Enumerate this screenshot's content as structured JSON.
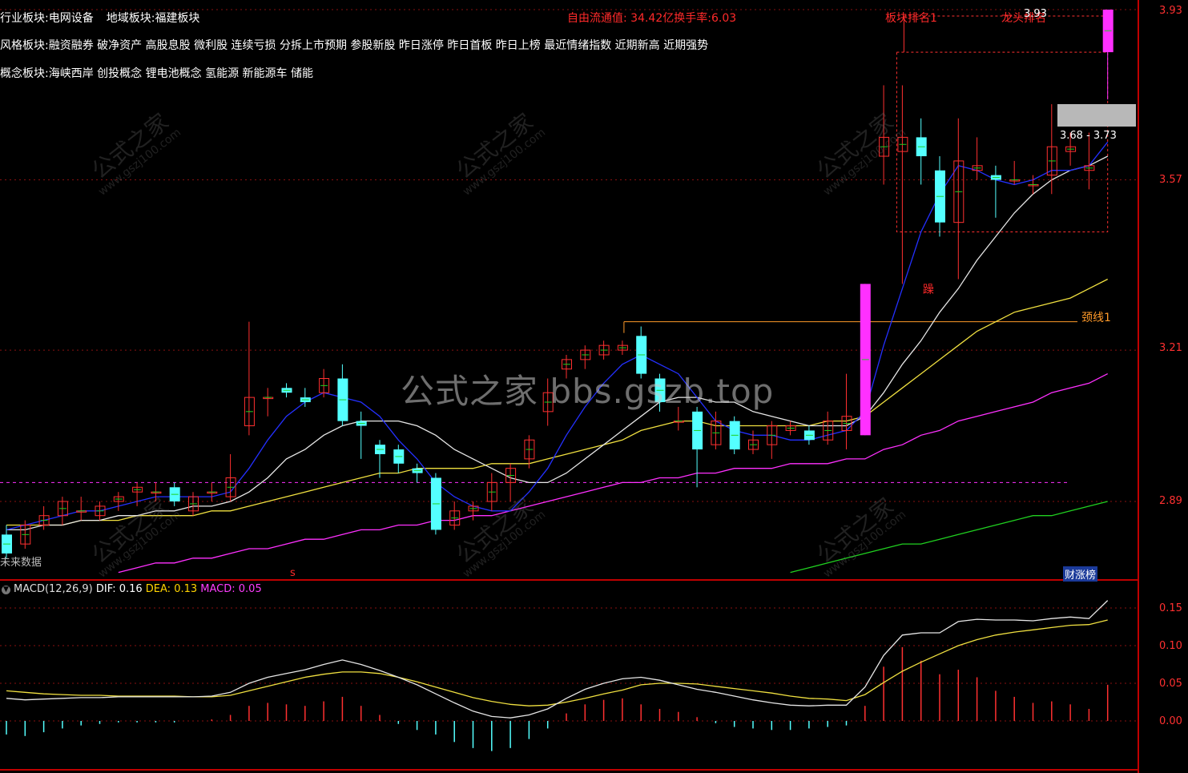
{
  "info": {
    "industry_label": "行业板块:",
    "industry_value": "电网设备",
    "region_label": "地域板块:",
    "region_value": "福建板块",
    "style_label": "风格板块:",
    "style_value": "融资融券 破净资产 高股息股 微利股 连续亏损 分拆上市预期 参股新股 昨日涨停 昨日首板 昨日上榜 最近情绪指数 近期新高 近期强势",
    "concept_label": "概念板块:",
    "concept_value": "海峡西岸 创投概念 锂电池概念 氢能源 新能源车 储能",
    "float_cap": "自由流通值: 34.42亿换手率:6.03"
  },
  "annotations": {
    "neckline": "颈线1",
    "range": "3.68 - 3.73",
    "rank": "板块排名1",
    "rank2": "龙头排名",
    "price_high": "3.93",
    "future_data": "未来数据",
    "flag": "财涨榜",
    "stamp": "躁",
    "s_mark": "s"
  },
  "price_axis": [
    "3.93",
    "3.57",
    "3.21",
    "2.89"
  ],
  "macd_axis": [
    "0.15",
    "0.10",
    "0.05",
    "0.00"
  ],
  "macd": {
    "title": "MACD(12,26,9)",
    "dif": "DIF: 0.16",
    "dea": "DEA: 0.13",
    "macd": "MACD: 0.05"
  },
  "watermark": {
    "main": "公式之家 bbs.gszb.top",
    "small": "公式之家",
    "url": "www.gszj100.com"
  },
  "colors": {
    "up": "#ff3030",
    "down": "#54ffff",
    "ma5": "#2430ff",
    "ma10": "#e6e6e6",
    "ma20": "#f0e040",
    "ma60": "#ff30ff",
    "ma120": "#20d020",
    "limit_up": "#ff30ff"
  },
  "chart_data": {
    "type": "candlestick",
    "price_range": [
      2.77,
      3.93
    ],
    "candles": [
      {
        "o": 2.82,
        "c": 2.78,
        "h": 2.84,
        "l": 2.77
      },
      {
        "o": 2.8,
        "c": 2.84,
        "h": 2.85,
        "l": 2.79
      },
      {
        "o": 2.84,
        "c": 2.86,
        "h": 2.88,
        "l": 2.83
      },
      {
        "o": 2.86,
        "c": 2.89,
        "h": 2.9,
        "l": 2.84
      },
      {
        "o": 2.87,
        "c": 2.87,
        "h": 2.9,
        "l": 2.85
      },
      {
        "o": 2.86,
        "c": 2.88,
        "h": 2.89,
        "l": 2.85
      },
      {
        "o": 2.89,
        "c": 2.9,
        "h": 2.91,
        "l": 2.87
      },
      {
        "o": 2.91,
        "c": 2.92,
        "h": 2.93,
        "l": 2.88
      },
      {
        "o": 2.91,
        "c": 2.91,
        "h": 2.93,
        "l": 2.89
      },
      {
        "o": 2.92,
        "c": 2.89,
        "h": 2.93,
        "l": 2.88
      },
      {
        "o": 2.87,
        "c": 2.9,
        "h": 2.91,
        "l": 2.86
      },
      {
        "o": 2.91,
        "c": 2.91,
        "h": 2.93,
        "l": 2.89
      },
      {
        "o": 2.9,
        "c": 2.94,
        "h": 2.99,
        "l": 2.89
      },
      {
        "o": 3.05,
        "c": 3.11,
        "h": 3.27,
        "l": 3.03
      },
      {
        "o": 3.11,
        "c": 3.11,
        "h": 3.13,
        "l": 3.07
      },
      {
        "o": 3.13,
        "c": 3.12,
        "h": 3.14,
        "l": 3.11
      },
      {
        "o": 3.11,
        "c": 3.1,
        "h": 3.13,
        "l": 3.09
      },
      {
        "o": 3.12,
        "c": 3.15,
        "h": 3.17,
        "l": 3.11
      },
      {
        "o": 3.15,
        "c": 3.06,
        "h": 3.18,
        "l": 3.05
      },
      {
        "o": 3.06,
        "c": 3.05,
        "h": 3.08,
        "l": 2.98
      },
      {
        "o": 3.01,
        "c": 2.99,
        "h": 3.02,
        "l": 2.94
      },
      {
        "o": 3.0,
        "c": 2.97,
        "h": 3.01,
        "l": 2.95
      },
      {
        "o": 2.96,
        "c": 2.95,
        "h": 2.97,
        "l": 2.93
      },
      {
        "o": 2.94,
        "c": 2.83,
        "h": 2.95,
        "l": 2.82
      },
      {
        "o": 2.84,
        "c": 2.87,
        "h": 2.89,
        "l": 2.83
      },
      {
        "o": 2.87,
        "c": 2.88,
        "h": 2.89,
        "l": 2.85
      },
      {
        "o": 2.89,
        "c": 2.93,
        "h": 2.95,
        "l": 2.87
      },
      {
        "o": 2.93,
        "c": 2.96,
        "h": 2.97,
        "l": 2.89
      },
      {
        "o": 2.98,
        "c": 3.02,
        "h": 3.03,
        "l": 2.96
      },
      {
        "o": 3.08,
        "c": 3.12,
        "h": 3.15,
        "l": 3.05
      },
      {
        "o": 3.17,
        "c": 3.19,
        "h": 3.2,
        "l": 3.15
      },
      {
        "o": 3.19,
        "c": 3.21,
        "h": 3.22,
        "l": 3.17
      },
      {
        "o": 3.2,
        "c": 3.22,
        "h": 3.23,
        "l": 3.19
      },
      {
        "o": 3.21,
        "c": 3.22,
        "h": 3.23,
        "l": 3.2
      },
      {
        "o": 3.24,
        "c": 3.16,
        "h": 3.26,
        "l": 3.15
      },
      {
        "o": 3.15,
        "c": 3.1,
        "h": 3.16,
        "l": 3.08
      },
      {
        "o": 3.06,
        "c": 3.06,
        "h": 3.09,
        "l": 3.04
      },
      {
        "o": 3.08,
        "c": 3.0,
        "h": 3.09,
        "l": 2.92
      },
      {
        "o": 3.01,
        "c": 3.06,
        "h": 3.08,
        "l": 3.0
      },
      {
        "o": 3.06,
        "c": 3.0,
        "h": 3.07,
        "l": 2.99
      },
      {
        "o": 3.0,
        "c": 3.02,
        "h": 3.04,
        "l": 2.99
      },
      {
        "o": 3.01,
        "c": 3.05,
        "h": 3.06,
        "l": 2.98
      },
      {
        "o": 3.04,
        "c": 3.05,
        "h": 3.06,
        "l": 3.03
      },
      {
        "o": 3.04,
        "c": 3.02,
        "h": 3.05,
        "l": 3.01
      },
      {
        "o": 3.02,
        "c": 3.06,
        "h": 3.08,
        "l": 3.01
      },
      {
        "o": 3.04,
        "c": 3.07,
        "h": 3.16,
        "l": 3.0
      },
      {
        "o": 3.03,
        "c": 3.35,
        "h": 3.35,
        "l": 3.03
      },
      {
        "o": 3.62,
        "c": 3.66,
        "h": 3.77,
        "l": 3.56
      },
      {
        "o": 3.63,
        "c": 3.66,
        "h": 3.77,
        "l": 3.35
      },
      {
        "o": 3.66,
        "c": 3.62,
        "h": 3.7,
        "l": 3.56
      },
      {
        "o": 3.59,
        "c": 3.48,
        "h": 3.62,
        "l": 3.45
      },
      {
        "o": 3.48,
        "c": 3.61,
        "h": 3.7,
        "l": 3.36
      },
      {
        "o": 3.59,
        "c": 3.6,
        "h": 3.66,
        "l": 3.57
      },
      {
        "o": 3.58,
        "c": 3.57,
        "h": 3.6,
        "l": 3.49
      },
      {
        "o": 3.57,
        "c": 3.57,
        "h": 3.61,
        "l": 3.56
      },
      {
        "o": 3.56,
        "c": 3.56,
        "h": 3.58,
        "l": 3.54
      },
      {
        "o": 3.58,
        "c": 3.64,
        "h": 3.73,
        "l": 3.54
      },
      {
        "o": 3.63,
        "c": 3.64,
        "h": 3.67,
        "l": 3.6
      },
      {
        "o": 3.59,
        "c": 3.6,
        "h": 3.67,
        "l": 3.55
      },
      {
        "o": 3.84,
        "c": 3.93,
        "h": 3.93,
        "l": 3.74
      }
    ],
    "limit_up_days": [
      46,
      59
    ],
    "ma5": [
      2.83,
      2.84,
      2.85,
      2.86,
      2.87,
      2.87,
      2.88,
      2.89,
      2.9,
      2.9,
      2.9,
      2.9,
      2.91,
      2.96,
      3.02,
      3.07,
      3.1,
      3.12,
      3.11,
      3.1,
      3.07,
      3.02,
      2.98,
      2.93,
      2.9,
      2.88,
      2.87,
      2.87,
      2.91,
      2.96,
      3.03,
      3.09,
      3.14,
      3.18,
      3.2,
      3.18,
      3.16,
      3.11,
      3.06,
      3.04,
      3.03,
      3.03,
      3.02,
      3.02,
      3.03,
      3.04,
      3.08,
      3.22,
      3.34,
      3.46,
      3.54,
      3.6,
      3.59,
      3.57,
      3.56,
      3.57,
      3.59,
      3.59,
      3.6,
      3.65
    ],
    "ma10": [
      2.83,
      2.83,
      2.84,
      2.84,
      2.85,
      2.85,
      2.86,
      2.86,
      2.87,
      2.87,
      2.88,
      2.88,
      2.89,
      2.91,
      2.94,
      2.98,
      3.0,
      3.03,
      3.05,
      3.06,
      3.06,
      3.06,
      3.05,
      3.03,
      3.0,
      2.98,
      2.96,
      2.94,
      2.93,
      2.93,
      2.95,
      2.98,
      3.01,
      3.04,
      3.07,
      3.1,
      3.11,
      3.11,
      3.1,
      3.1,
      3.08,
      3.07,
      3.06,
      3.05,
      3.05,
      3.05,
      3.07,
      3.12,
      3.18,
      3.23,
      3.29,
      3.34,
      3.4,
      3.45,
      3.5,
      3.54,
      3.57,
      3.59,
      3.6,
      3.62
    ],
    "ma20": [
      2.84,
      2.84,
      2.84,
      2.84,
      2.85,
      2.85,
      2.85,
      2.86,
      2.86,
      2.86,
      2.86,
      2.87,
      2.87,
      2.88,
      2.89,
      2.9,
      2.91,
      2.92,
      2.93,
      2.94,
      2.95,
      2.95,
      2.96,
      2.96,
      2.96,
      2.96,
      2.97,
      2.97,
      2.97,
      2.98,
      2.99,
      3.0,
      3.01,
      3.02,
      3.04,
      3.05,
      3.06,
      3.06,
      3.05,
      3.05,
      3.05,
      3.05,
      3.05,
      3.05,
      3.06,
      3.06,
      3.07,
      3.1,
      3.13,
      3.16,
      3.19,
      3.22,
      3.25,
      3.27,
      3.29,
      3.3,
      3.31,
      3.32,
      3.34,
      3.36
    ],
    "ma60": [
      null,
      null,
      null,
      null,
      null,
      null,
      2.74,
      2.75,
      2.76,
      2.76,
      2.77,
      2.77,
      2.78,
      2.79,
      2.79,
      2.8,
      2.81,
      2.81,
      2.82,
      2.83,
      2.83,
      2.84,
      2.84,
      2.85,
      2.85,
      2.86,
      2.86,
      2.87,
      2.88,
      2.89,
      2.9,
      2.91,
      2.92,
      2.93,
      2.93,
      2.94,
      2.94,
      2.95,
      2.95,
      2.96,
      2.96,
      2.96,
      2.97,
      2.97,
      2.97,
      2.98,
      2.98,
      3.0,
      3.01,
      3.03,
      3.04,
      3.06,
      3.07,
      3.08,
      3.09,
      3.1,
      3.12,
      3.13,
      3.14,
      3.16
    ],
    "ma120": [
      null,
      null,
      null,
      null,
      null,
      null,
      null,
      null,
      null,
      null,
      null,
      null,
      null,
      null,
      null,
      null,
      null,
      null,
      null,
      null,
      null,
      null,
      null,
      null,
      null,
      null,
      null,
      null,
      null,
      null,
      null,
      null,
      null,
      null,
      null,
      null,
      null,
      null,
      null,
      null,
      null,
      null,
      2.74,
      2.75,
      2.76,
      2.77,
      2.78,
      2.79,
      2.8,
      2.8,
      2.81,
      2.82,
      2.83,
      2.84,
      2.85,
      2.86,
      2.86,
      2.87,
      2.88,
      2.89
    ],
    "neckline": 3.27,
    "dashed_level": 2.93,
    "box": {
      "from": 48,
      "to": 59,
      "top": 3.84,
      "bottom": 3.46,
      "upper_top": 3.93
    },
    "macd_range": [
      -0.019,
      0.17
    ],
    "dif": [
      0.03,
      0.028,
      0.029,
      0.03,
      0.031,
      0.031,
      0.032,
      0.032,
      0.032,
      0.032,
      0.032,
      0.033,
      0.038,
      0.05,
      0.058,
      0.063,
      0.068,
      0.075,
      0.081,
      0.075,
      0.067,
      0.058,
      0.048,
      0.036,
      0.024,
      0.013,
      0.006,
      0.004,
      0.008,
      0.016,
      0.03,
      0.042,
      0.05,
      0.056,
      0.058,
      0.054,
      0.048,
      0.042,
      0.038,
      0.033,
      0.028,
      0.024,
      0.021,
      0.02,
      0.021,
      0.021,
      0.045,
      0.087,
      0.114,
      0.117,
      0.117,
      0.132,
      0.135,
      0.134,
      0.134,
      0.133,
      0.136,
      0.138,
      0.136,
      0.16
    ],
    "dea": [
      0.04,
      0.038,
      0.036,
      0.035,
      0.034,
      0.034,
      0.033,
      0.033,
      0.033,
      0.033,
      0.032,
      0.032,
      0.034,
      0.04,
      0.046,
      0.052,
      0.058,
      0.062,
      0.065,
      0.065,
      0.063,
      0.058,
      0.052,
      0.045,
      0.038,
      0.031,
      0.026,
      0.022,
      0.02,
      0.021,
      0.025,
      0.03,
      0.036,
      0.041,
      0.048,
      0.05,
      0.05,
      0.049,
      0.046,
      0.043,
      0.04,
      0.037,
      0.033,
      0.03,
      0.029,
      0.027,
      0.035,
      0.051,
      0.066,
      0.078,
      0.089,
      0.1,
      0.108,
      0.114,
      0.118,
      0.121,
      0.124,
      0.127,
      0.128,
      0.134
    ],
    "hist": [
      -0.018,
      -0.02,
      -0.015,
      -0.01,
      -0.006,
      -0.004,
      -0.002,
      -0.002,
      -0.002,
      -0.002,
      0,
      0.002,
      0.008,
      0.02,
      0.024,
      0.022,
      0.02,
      0.026,
      0.032,
      0.02,
      0.008,
      -0.004,
      -0.012,
      -0.018,
      -0.028,
      -0.036,
      -0.04,
      -0.036,
      -0.024,
      -0.01,
      0.01,
      0.022,
      0.028,
      0.03,
      0.022,
      0.016,
      0.012,
      0.005,
      -0.003,
      -0.008,
      -0.01,
      -0.012,
      -0.012,
      -0.01,
      -0.008,
      -0.006,
      0.02,
      0.072,
      0.098,
      0.08,
      0.062,
      0.068,
      0.058,
      0.04,
      0.032,
      0.024,
      0.026,
      0.022,
      0.016,
      0.048
    ]
  }
}
